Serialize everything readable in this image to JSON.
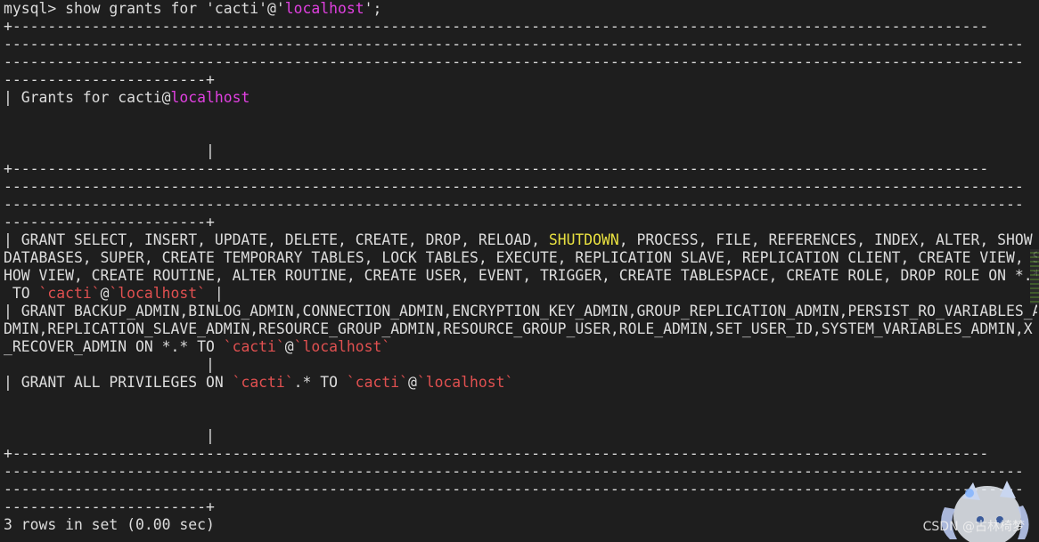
{
  "prompt": "mysql> show grants for 'cacti'@'",
  "prompt_host": "localhost",
  "prompt_end": "';",
  "border_plus": "+---------------------------------------------------------------------------------------------------------------",
  "border_dash": "--------------------------------------------------------------------------------------------------------------------",
  "border_end": "-----------------------+",
  "header_prefix": "| Grants for cacti@",
  "header_host": "localhost",
  "pipe_line": "                       |",
  "grant1": {
    "a": "| GRANT SELECT, INSERT, UPDATE, DELETE, CREATE, DROP, RELOAD, ",
    "highlight": "SHUTDOWN",
    "b": ", PROCESS, FILE, REFERENCES, INDEX, ALTER, SHOW",
    "line2": "DATABASES, SUPER, CREATE TEMPORARY TABLES, LOCK TABLES, EXECUTE, REPLICATION SLAVE, REPLICATION CLIENT, CREATE VIEW, S",
    "line3": "HOW VIEW, CREATE ROUTINE, ALTER ROUTINE, CREATE USER, EVENT, TRIGGER, CREATE TABLESPACE, CREATE ROLE, DROP ROLE ON *.*",
    "to": " TO ",
    "user": "`cacti`",
    "at": "@",
    "host": "`localhost`",
    "end": " |"
  },
  "grant2": {
    "line1": "| GRANT BACKUP_ADMIN,BINLOG_ADMIN,CONNECTION_ADMIN,ENCRYPTION_KEY_ADMIN,GROUP_REPLICATION_ADMIN,PERSIST_RO_VARIABLES_A",
    "line2": "DMIN,REPLICATION_SLAVE_ADMIN,RESOURCE_GROUP_ADMIN,RESOURCE_GROUP_USER,ROLE_ADMIN,SET_USER_ID,SYSTEM_VARIABLES_ADMIN,X",
    "line3a": "_RECOVER_ADMIN ON *.* TO ",
    "user": "`cacti`",
    "at": "@",
    "host": "`localhost`"
  },
  "grant3": {
    "a": "| GRANT ALL PRIVILEGES ON ",
    "db": "`cacti`",
    "b": ".* TO ",
    "user": "`cacti`",
    "at": "@",
    "host": "`localhost`"
  },
  "result": "3 rows in set (0.00 sec)",
  "watermark": "CSDN @古林椅梦",
  "colors": {
    "background": "#1e1e1e",
    "text": "#dcdcdc",
    "host": "#e040e0",
    "quoted": "#e05050",
    "keyword": "#e8e040"
  }
}
